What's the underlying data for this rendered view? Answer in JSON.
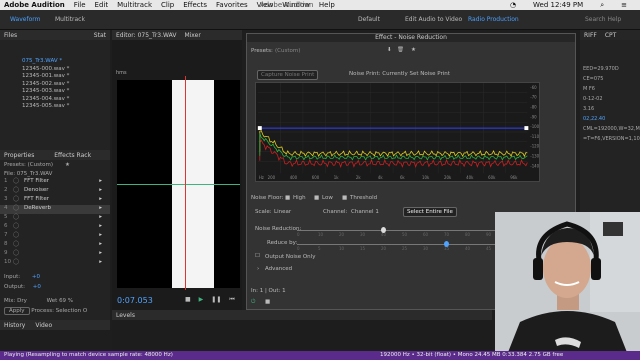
{
  "menubar": {
    "apple": "",
    "app": "Adobe Audition",
    "items": [
      "File",
      "Edit",
      "Multitrack",
      "Clip",
      "Effects",
      "Favorites",
      "View",
      "Window",
      "Help"
    ],
    "time": "Wed 12:49 PM",
    "window_title": "Adobe Audition"
  },
  "toolbar": {
    "waveform": "Waveform",
    "multitrack": "Multitrack",
    "default": "Default",
    "edit_video": "Edit Audio to Video",
    "radio": "Radio Production",
    "search": "Search Help"
  },
  "files": {
    "title": "Files",
    "stat": "Stat",
    "items": [
      "075_Tr3.WAV *",
      "12345-000.wav *",
      "12345-001.wav *",
      "12345-002.wav *",
      "12345-003.wav *",
      "12345-004.wav *",
      "12345-005.wav *"
    ]
  },
  "effects": {
    "tabs": [
      "Properties",
      "Effects Rack"
    ],
    "presets_label": "Presets:",
    "presets_value": "(Custom)",
    "file_label": "File: 075_Tr3.WAV",
    "items": [
      {
        "n": "1",
        "name": "FFT Filter"
      },
      {
        "n": "2",
        "name": "Denoiser"
      },
      {
        "n": "3",
        "name": "FFT Filter"
      },
      {
        "n": "4",
        "name": "DeReverb"
      },
      {
        "n": "5",
        "name": ""
      },
      {
        "n": "6",
        "name": ""
      },
      {
        "n": "7",
        "name": ""
      },
      {
        "n": "8",
        "name": ""
      },
      {
        "n": "9",
        "name": ""
      },
      {
        "n": "10",
        "name": ""
      }
    ],
    "input_label": "Input:",
    "input_val": "+0",
    "output_label": "Output:",
    "output_val": "+0",
    "mix_label": "Mix:",
    "dry": "Dry",
    "wet": "Wet",
    "mix_pct": "69 %",
    "apply": "Apply",
    "process_label": "Process:",
    "process_val": "Selection O"
  },
  "bottomtabs": [
    "History",
    "Video"
  ],
  "editor": {
    "title": "Editor: 075_Tr3.WAV",
    "mixer": "Mixer",
    "timecode": "0:07.053",
    "ruler": "hms"
  },
  "dialog": {
    "title": "Effect - Noise Reduction",
    "presets_label": "Presets:",
    "presets_value": "(Custom)",
    "capture_btn": "Capture Noise Print",
    "noise_print_text": "Noise Print: Currently Set Noise Print",
    "noise_floor": "Noise Floor:",
    "high": "High",
    "low": "Low",
    "threshold": "Threshold",
    "scale_label": "Scale:",
    "scale_val": "Linear",
    "channel_label": "Channel:",
    "channel_val": "Channel 1",
    "select_entire": "Select Entire File",
    "nr_label": "Noise Reduction:",
    "nr_ticks": [
      "0",
      "10",
      "20",
      "30",
      "40",
      "50",
      "60",
      "70",
      "80",
      "90",
      "100"
    ],
    "reduce_label": "Reduce by:",
    "reduce_ticks": [
      "0",
      "5",
      "10",
      "15",
      "20",
      "25",
      "30",
      "35",
      "40",
      "45",
      "50"
    ],
    "output_noise": "Output Noise Only",
    "advanced": "Advanced",
    "io_text": "In: 1 | Out: 1",
    "hz_label": "Hz",
    "dB_ticks": [
      "-60",
      "-70",
      "-80",
      "-90",
      "-100",
      "-110",
      "-120",
      "-130",
      "-140"
    ],
    "hz_ticks": [
      "200",
      "400",
      "600",
      "1k",
      "2k",
      "4k",
      "6k",
      "10k",
      "20k",
      "40k",
      "60k",
      "96k"
    ]
  },
  "levels": {
    "title": "Levels"
  },
  "rightpanel": {
    "tab": "RIFF",
    "tab2": "CPT",
    "lines": [
      "EED=29.970D",
      "CE=075",
      "M F6",
      "0-12-02",
      "3.16",
      "02,22.40",
      "CML=192000,W=32,M=",
      "=T=F6,VERSION=1,10,1:"
    ]
  },
  "status": {
    "left": "Playing (Resampling to match device sample rate: 48000 Hz)",
    "right": "192000 Hz • 32-bit (float) • Mono     24.45 MB     0:33.384     2.75 GB free"
  }
}
